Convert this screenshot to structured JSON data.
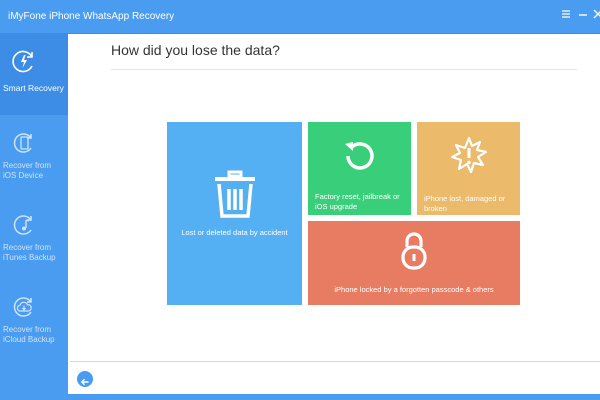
{
  "app": {
    "title": "iMyFone iPhone WhatsApp Recovery"
  },
  "window_controls": [
    "menu-icon",
    "minimize-icon",
    "close-icon"
  ],
  "sidebar": {
    "items": [
      {
        "label": "Smart Recovery",
        "icon": "refresh-lightning-icon",
        "active": true
      },
      {
        "label_line1": "Recover from",
        "label_line2": "iOS Device",
        "icon": "phone-recover-icon",
        "active": false
      },
      {
        "label_line1": "Recover from",
        "label_line2": "iTunes Backup",
        "icon": "itunes-note-icon",
        "active": false
      },
      {
        "label_line1": "Recover from",
        "label_line2": "iCloud Backup",
        "icon": "cloud-icon",
        "active": false
      }
    ]
  },
  "main": {
    "title": "How did you lose the data?",
    "options": [
      {
        "label": "Lost or deleted data by accident",
        "icon": "trash-icon",
        "color": "#55aff3"
      },
      {
        "label_line1": "Factory reset, jailbreak or",
        "label_line2": "iOS upgrade",
        "icon": "restore-icon",
        "color": "#39cf7a"
      },
      {
        "label_line1": "iPhone lost, damaged or",
        "label_line2": "broken",
        "icon": "broken-warning-icon",
        "color": "#ebba6a"
      },
      {
        "label": "iPhone locked by a forgotten passcode & others",
        "icon": "padlock-icon",
        "color": "#e87c62"
      }
    ]
  },
  "footer": {
    "back_icon": "arrow-left-icon"
  },
  "colors": {
    "brand": "#4a9cf0",
    "sidebar_active": "#3d8de6"
  }
}
